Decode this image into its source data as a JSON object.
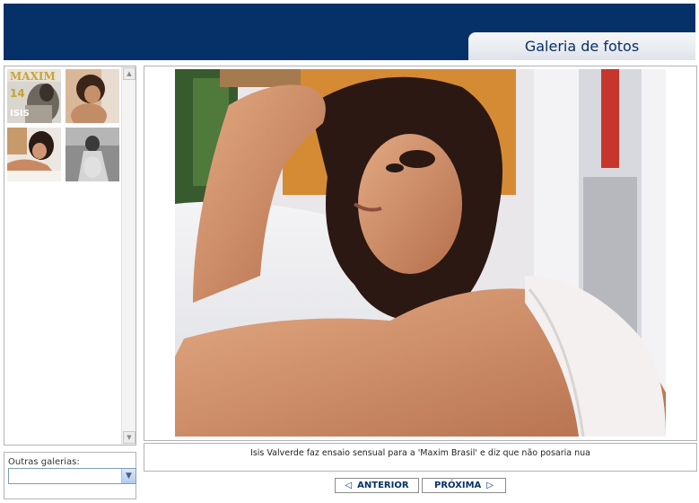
{
  "header": {
    "title": "Galeria de fotos"
  },
  "thumbnails": [
    {
      "icon": "magazine-cover-thumbnail",
      "cover_text": "MAXIM",
      "issue": "14",
      "name_text": "ISIS"
    },
    {
      "icon": "photo-thumbnail"
    },
    {
      "icon": "photo-thumbnail"
    },
    {
      "icon": "photo-thumbnail"
    }
  ],
  "other_galleries": {
    "label": "Outras galerias:",
    "selected": ""
  },
  "photo": {
    "caption": "Isis Valverde faz ensaio sensual para a 'Maxim Brasil' e diz que não posaria nua"
  },
  "navigation": {
    "prev_label": "ANTERIOR",
    "next_label": "PRÓXIMA"
  },
  "colors": {
    "header_bg": "#063168",
    "accent_text": "#063168"
  }
}
